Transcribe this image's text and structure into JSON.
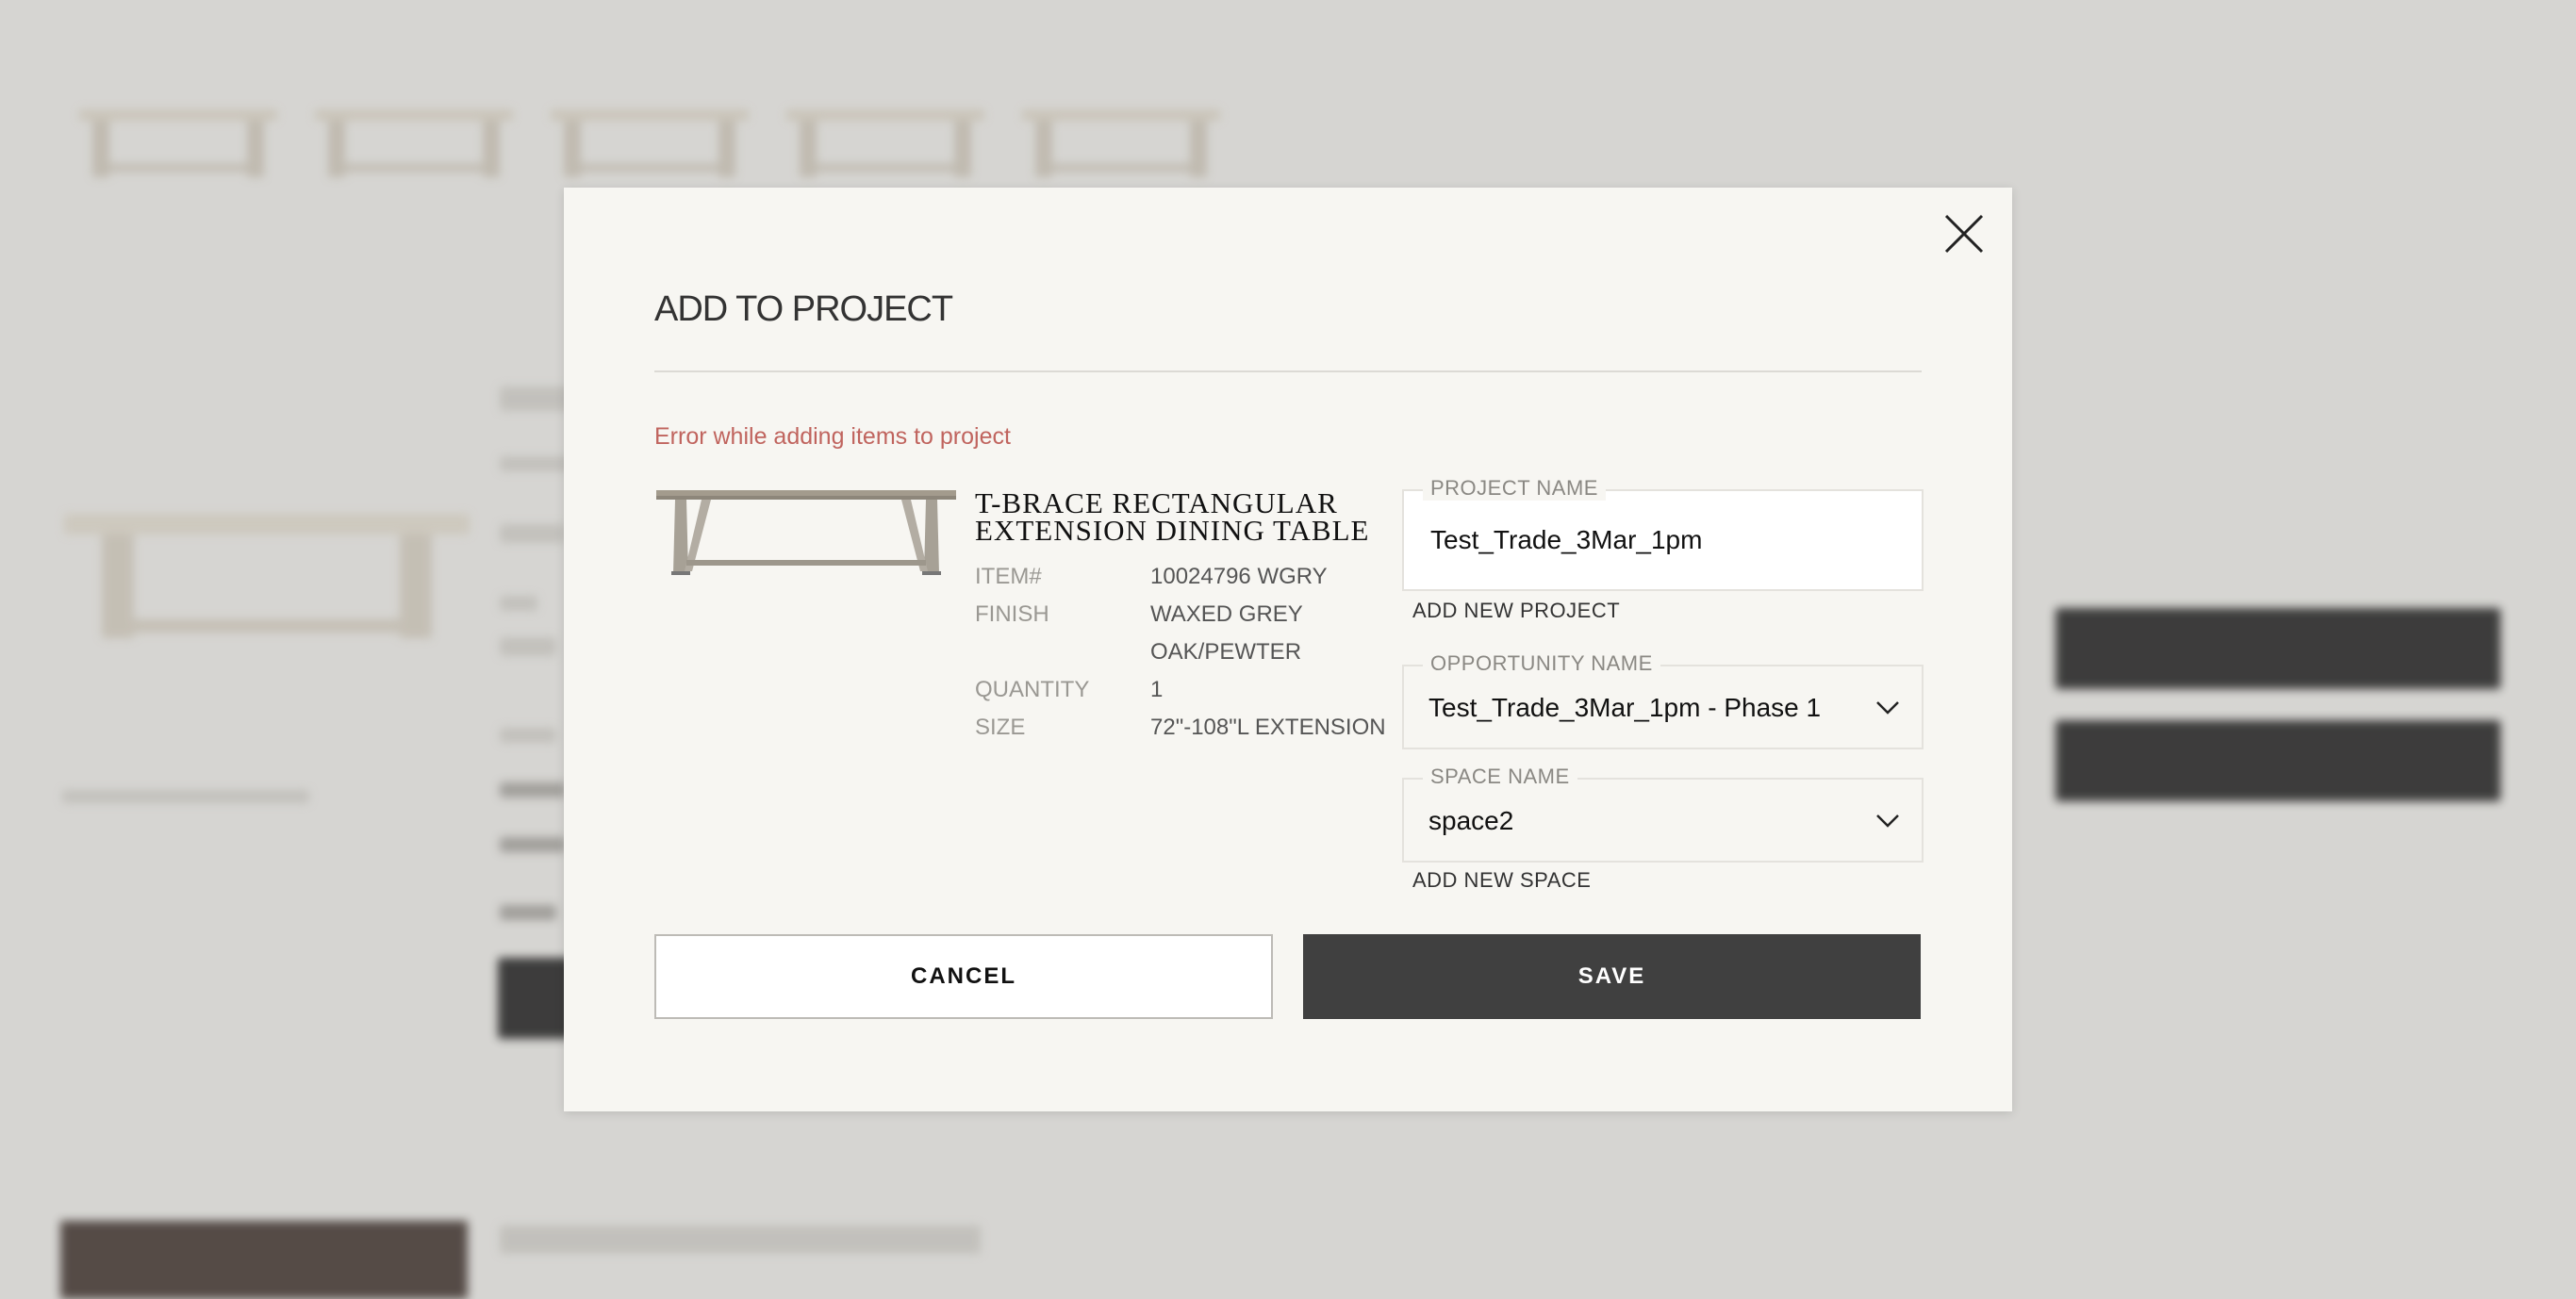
{
  "modal": {
    "title": "ADD TO PROJECT",
    "error_message": "Error while adding items to project",
    "product": {
      "name": "T-BRACE RECTANGULAR EXTENSION DINING TABLE",
      "specs": [
        {
          "label": "ITEM#",
          "value": "10024796 WGRY"
        },
        {
          "label": "FINISH",
          "value": "WAXED GREY"
        },
        {
          "label": "",
          "value": "OAK/PEWTER"
        },
        {
          "label": "QUANTITY",
          "value": "1"
        },
        {
          "label": "SIZE",
          "value": "72\"-108\"L EXTENSION"
        }
      ]
    },
    "project_name": {
      "label": "PROJECT NAME",
      "value": "Test_Trade_3Mar_1pm"
    },
    "add_new_project": "ADD NEW PROJECT",
    "opportunity_name": {
      "label": "OPPORTUNITY NAME",
      "value": "Test_Trade_3Mar_1pm - Phase 1"
    },
    "space_name": {
      "label": "SPACE NAME",
      "value": "space2"
    },
    "add_new_space": "ADD NEW SPACE",
    "cancel_label": "CANCEL",
    "save_label": "SAVE"
  },
  "colors": {
    "error": "#c0645e",
    "save_button": "#404040",
    "modal_bg": "#f7f6f2",
    "overlay_bg": "#d6d5d2"
  },
  "icons": [
    "close-icon",
    "chevron-down-icon"
  ]
}
